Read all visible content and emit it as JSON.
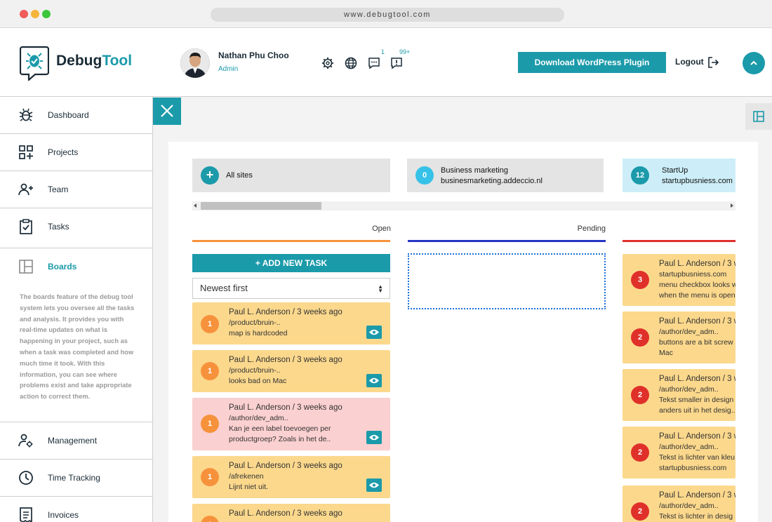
{
  "browser": {
    "url": "www.debugtool.com",
    "dots": [
      "#f15c5c",
      "#f5b53c",
      "#3cc63c"
    ]
  },
  "header": {
    "logo_part1": "Debug",
    "logo_part2": "Tool",
    "user_name": "Nathan Phu Choo",
    "user_role": "Admin",
    "chat_badge": "1",
    "alert_badge": "99+",
    "download_label": "Download WordPress Plugin",
    "logout_label": "Logout"
  },
  "sidebar": {
    "items": [
      {
        "label": "Dashboard",
        "icon": "bug-icon"
      },
      {
        "label": "Projects",
        "icon": "projects-grid-icon"
      },
      {
        "label": "Team",
        "icon": "team-add-icon"
      },
      {
        "label": "Tasks",
        "icon": "clipboard-check-icon"
      },
      {
        "label": "Boards",
        "icon": "boards-layout-icon"
      },
      {
        "label": "Management",
        "icon": "user-gear-icon"
      },
      {
        "label": "Time Tracking",
        "icon": "clock-icon"
      },
      {
        "label": "Invoices",
        "icon": "invoice-icon"
      }
    ],
    "boards_description": "The boards feature of the debug tool system lets you oversee all the tasks and analysis. It provides you with real-time updates on what is happening in your project, such as when a task was completed and how much time it took. With this information, you can see where problems exist and take appropriate action to correct them."
  },
  "sites": [
    {
      "count": "+",
      "title": "All sites",
      "url": ""
    },
    {
      "count": "0",
      "title": "Business marketing",
      "url": "businesmarketing.addeccio.nl"
    },
    {
      "count": "12",
      "title": "StartUp",
      "url": "startupbusniess.com"
    }
  ],
  "columns": {
    "open": {
      "title": "Open",
      "color": "#f7923c"
    },
    "pending": {
      "title": "Pending",
      "color": "#2436c4"
    },
    "third": {
      "title": "",
      "color": "#e0302a"
    }
  },
  "board": {
    "add_task_label": "+ ADD NEW TASK",
    "sort_value": "Newest first"
  },
  "open_tasks": [
    {
      "priority": "1",
      "meta": "Paul L. Anderson / 3 weeks ago",
      "path": "/product/bruin-..",
      "text1": "map is hardcoded",
      "text2": ""
    },
    {
      "priority": "1",
      "meta": "Paul L. Anderson / 3 weeks ago",
      "path": "/product/bruin-..",
      "text1": "looks bad on Mac",
      "text2": ""
    },
    {
      "priority": "1",
      "meta": "Paul L. Anderson / 3 weeks ago",
      "path": "/author/dev_adm..",
      "text1": "Kan je een label toevoegen per",
      "text2": "productgroep? Zoals in het de.."
    },
    {
      "priority": "1",
      "meta": "Paul L. Anderson / 3 weeks ago",
      "path": "/afrekenen",
      "text1": "Lijnt niet uit.",
      "text2": ""
    },
    {
      "priority": "1",
      "meta": "Paul L. Anderson / 3 weeks ago",
      "path": "",
      "text1": "",
      "text2": ""
    }
  ],
  "third_tasks": [
    {
      "priority": "3",
      "meta": "Paul L. Anderson / 3 w",
      "path": "startupbusniess.com",
      "text1": "menu checkbox looks w",
      "text2": "when the menu is open"
    },
    {
      "priority": "2",
      "meta": "Paul L. Anderson / 3 w",
      "path": "/author/dev_adm..",
      "text1": "buttons are a bit screw",
      "text2": "Mac"
    },
    {
      "priority": "2",
      "meta": "Paul L. Anderson / 3 w",
      "path": "/author/dev_adm..",
      "text1": "Tekst smaller in design",
      "text2": "anders uit in het desig.."
    },
    {
      "priority": "2",
      "meta": "Paul L. Anderson / 3 w",
      "path": "/author/dev_adm..",
      "text1": "Tekst is lichter van kleu",
      "text2": "startupbusniess.com"
    },
    {
      "priority": "2",
      "meta": "Paul L. Anderson / 3 w",
      "path": "/author/dev_adm..",
      "text1": "Tekst is lichter in desig",
      "text2": ""
    }
  ]
}
